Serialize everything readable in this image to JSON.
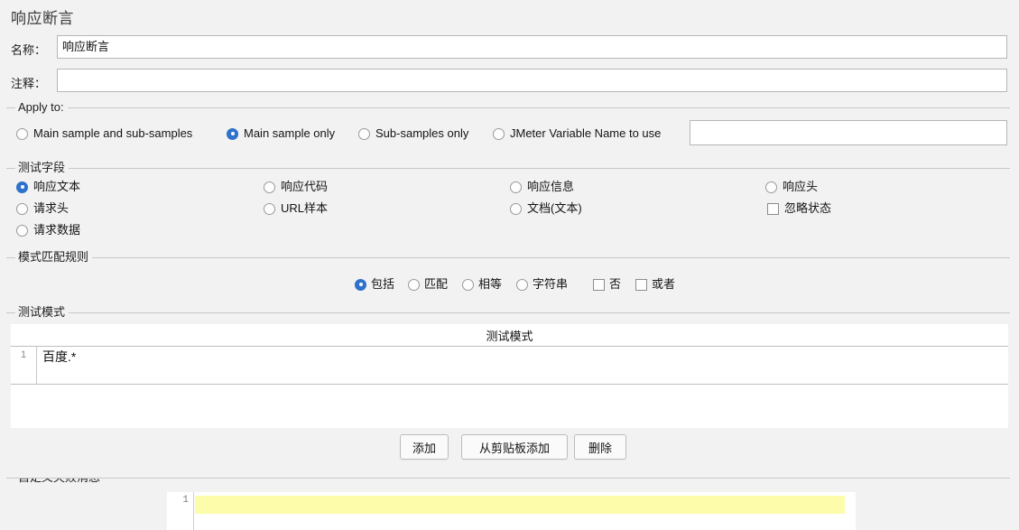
{
  "panel": {
    "title": "响应断言"
  },
  "fields": {
    "name_label": "名称：",
    "name_value": "响应断言",
    "comment_label": "注释：",
    "comment_value": "",
    "comment_placeholder": ""
  },
  "apply_to": {
    "legend": "Apply to:",
    "options": [
      {
        "label": "Main sample and sub-samples",
        "selected": false
      },
      {
        "label": "Main sample only",
        "selected": true
      },
      {
        "label": "Sub-samples only",
        "selected": false
      },
      {
        "label": "JMeter Variable Name to use",
        "selected": false
      }
    ],
    "variable_value": "",
    "variable_placeholder": ""
  },
  "test_field": {
    "legend": "测试字段",
    "options": [
      {
        "label": "响应文本",
        "type": "radio",
        "selected": true
      },
      {
        "label": "响应代码",
        "type": "radio",
        "selected": false
      },
      {
        "label": "响应信息",
        "type": "radio",
        "selected": false
      },
      {
        "label": "响应头",
        "type": "radio",
        "selected": false
      },
      {
        "label": "请求头",
        "type": "radio",
        "selected": false
      },
      {
        "label": "URL样本",
        "type": "radio",
        "selected": false
      },
      {
        "label": "文档(文本)",
        "type": "radio",
        "selected": false
      },
      {
        "label": "忽略状态",
        "type": "checkbox",
        "selected": false
      },
      {
        "label": "请求数据",
        "type": "radio",
        "selected": false
      }
    ]
  },
  "pattern_rule": {
    "legend": "模式匹配规则",
    "options": [
      {
        "label": "包括",
        "type": "radio",
        "selected": true
      },
      {
        "label": "匹配",
        "type": "radio",
        "selected": false
      },
      {
        "label": "相等",
        "type": "radio",
        "selected": false
      },
      {
        "label": "字符串",
        "type": "radio",
        "selected": false
      },
      {
        "label": "否",
        "type": "checkbox",
        "selected": false
      },
      {
        "label": "或者",
        "type": "checkbox",
        "selected": false
      }
    ]
  },
  "patterns": {
    "legend": "测试模式",
    "column_header": "测试模式",
    "rows": [
      {
        "index": "1",
        "value": "百度.*"
      }
    ]
  },
  "buttons": {
    "add": "添加",
    "add_from_clipboard": "从剪贴板添加",
    "delete": "删除"
  },
  "failure_message": {
    "legend": "自定义失败消息",
    "line_number": "1",
    "line_value": "",
    "highlight_color": "#fdfcaa"
  },
  "colors": {
    "background": "#f2f2f2",
    "field_background": "#ffffff",
    "accent": "#2f72cd",
    "border": "#c8c8c8"
  }
}
